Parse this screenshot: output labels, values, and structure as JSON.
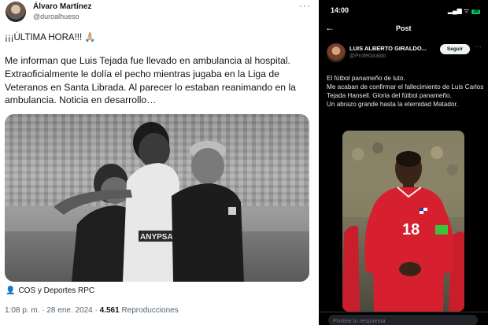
{
  "left_tweet": {
    "author_name": "Álvaro Martínez",
    "handle": "@duroalhueso",
    "more_icon": "more-horizontal-icon",
    "headline": "¡¡¡ÚLTIMA HORA!!! 🙏🏼",
    "body": "Me informan que Luis Tejada fue llevado en ambulancia al hospital. Extraoficialmente le dolía el pecho mientras jugaba en la Liga de Veteranos en Santa Librada. Al parecer lo estaban reanimando en la ambulancia. Noticia en desarrollo…",
    "photo": {
      "shirt_text": "ANYPSA"
    },
    "media_credit": "COS y Deportes RPC",
    "time": "1:08 p. m.",
    "date": "28 ene. 2024",
    "views_count": "4.561",
    "views_label": "Reproducciones"
  },
  "right_phone": {
    "status_time": "14:00",
    "status_icons": "▂▄▆ ᯤ",
    "battery": "39",
    "header_title": "Post",
    "back_icon": "arrow-left-icon",
    "author_name": "LUIS ALBERTO GIRALDO...",
    "handle": "@ProfeGiraldo",
    "follow_label": "Seguir",
    "body_lines": [
      "El fútbol panameño de luto.",
      "Me acaban de confirmar el fallecimiento de Luis Carlos Tejada Hansell. Gloria del fútbol panameño.",
      "Un abrazo grande hasta la eternidad Matador."
    ],
    "photo": {
      "jersey_number": "18"
    },
    "reply_placeholder": "Postea tu respuesta"
  },
  "colors": {
    "left_background": "#ffffff",
    "right_background": "#000000",
    "jersey_red": "#d6202f",
    "battery_green": "#00d065"
  }
}
